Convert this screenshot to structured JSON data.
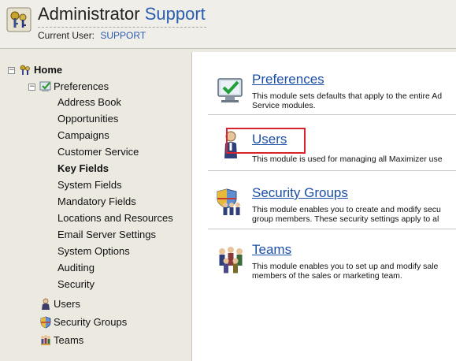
{
  "header": {
    "title_main": "Administrator",
    "title_accent": "Support",
    "current_user_label": "Current User:",
    "current_user_value": "SUPPORT"
  },
  "sidebar": {
    "home": {
      "label": "Home",
      "expander": "−"
    },
    "preferences": {
      "label": "Preferences",
      "expander": "−"
    },
    "pref_items": [
      "Address Book",
      "Opportunities",
      "Campaigns",
      "Customer Service",
      "Key Fields",
      "System Fields",
      "Mandatory Fields",
      "Locations and Resources",
      "Email Server Settings",
      "System Options",
      "Auditing",
      "Security"
    ],
    "users": "Users",
    "security_groups": "Security Groups",
    "teams": "Teams"
  },
  "main": {
    "modules": [
      {
        "title": "Preferences",
        "desc_line1": "This module sets defaults that apply to the entire Ad",
        "desc_line2": "Service modules.",
        "icon": "monitor-check-icon"
      },
      {
        "title": "Users",
        "desc_line1": "This module is used for managing all Maximizer use",
        "desc_line2": "",
        "icon": "user-icon"
      },
      {
        "title": "Security Groups",
        "desc_line1": "This module enables you to create and modify secu",
        "desc_line2": "group members. These security settings apply to al",
        "icon": "shield-group-icon"
      },
      {
        "title": "Teams",
        "desc_line1": "This module enables you to set up and modify sale",
        "desc_line2": "members of the sales or marketing team.",
        "icon": "team-icon"
      }
    ]
  },
  "colors": {
    "accent": "#2a5db0",
    "link": "#1b4fa6",
    "highlight": "#d9232e"
  }
}
